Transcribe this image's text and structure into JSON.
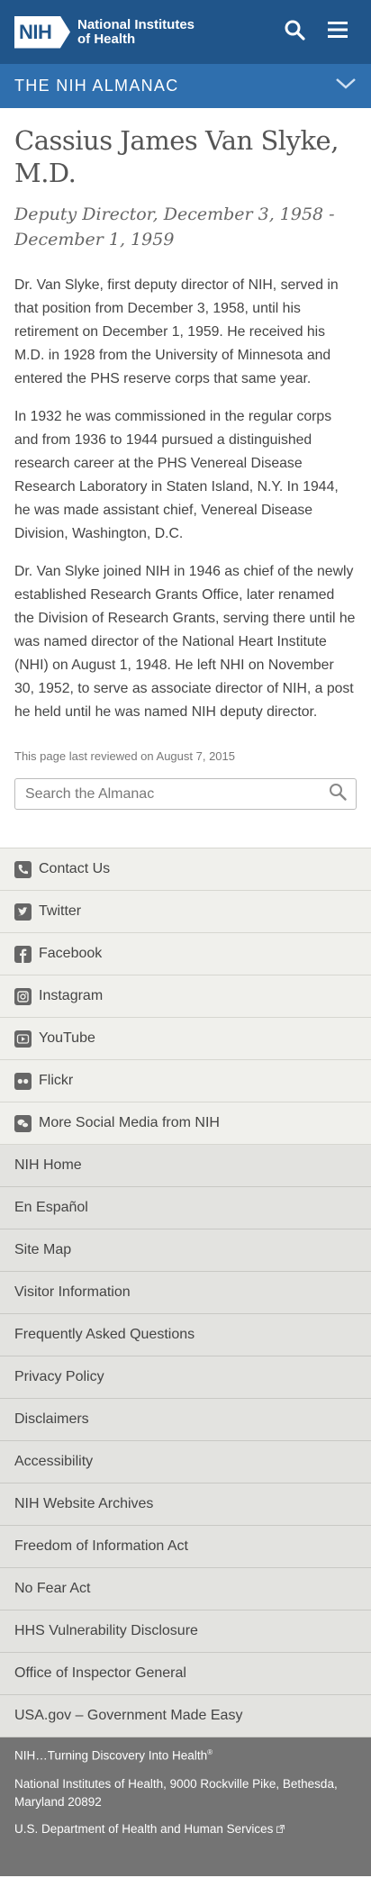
{
  "header": {
    "logo_mark": "NIH",
    "logo_line1": "National Institutes",
    "logo_line2": "of Health"
  },
  "almanac_bar": {
    "title": "THE NIH ALMANAC"
  },
  "main": {
    "title": "Cassius James Van Slyke, M.D.",
    "subtitle": "Deputy Director, December 3, 1958 - December 1, 1959",
    "paragraphs": [
      "Dr. Van Slyke, first deputy director of NIH, served in that position from December 3, 1958, until his retirement on December 1, 1959. He received his M.D. in 1928 from the University of Minnesota and entered the PHS reserve corps that same year.",
      "In 1932 he was commissioned in the regular corps and from 1936 to 1944 pursued a distinguished research career at the PHS Venereal Disease Research Laboratory in Staten Island, N.Y. In 1944, he was made assistant chief, Venereal Disease Division, Washington, D.C.",
      "Dr. Van Slyke joined NIH in 1946 as chief of the newly established Research Grants Office, later renamed the Division of Research Grants, serving there until he was named director of the National Heart Institute (NHI) on August 1, 1948. He left NHI on November 30, 1952, to serve as associate director of NIH, a post he held until he was named NIH deputy director."
    ],
    "reviewed": "This page last reviewed on August 7, 2015",
    "search_placeholder": "Search the Almanac"
  },
  "social_links": [
    {
      "label": "Contact Us",
      "icon": "phone-icon"
    },
    {
      "label": "Twitter",
      "icon": "twitter-icon"
    },
    {
      "label": "Facebook",
      "icon": "facebook-icon"
    },
    {
      "label": "Instagram",
      "icon": "instagram-icon"
    },
    {
      "label": "YouTube",
      "icon": "youtube-icon"
    },
    {
      "label": "Flickr",
      "icon": "flickr-icon"
    },
    {
      "label": "More Social Media from NIH",
      "icon": "social-media-icon"
    }
  ],
  "footer_links": [
    "NIH Home",
    "En Español",
    "Site Map",
    "Visitor Information",
    "Frequently Asked Questions",
    "Privacy Policy",
    "Disclaimers",
    "Accessibility",
    "NIH Website Archives",
    "Freedom of Information Act",
    "No Fear Act",
    "HHS Vulnerability Disclosure",
    "Office of Inspector General",
    "USA.gov – Government Made Easy"
  ],
  "bottom": {
    "tagline": "NIH…Turning Discovery Into Health",
    "tagline_mark": "®",
    "address": "National Institutes of Health, 9000 Rockville Pike, Bethesda, Maryland 20892",
    "hhs": "U.S. Department of Health and Human Services"
  },
  "colors": {
    "header_bg": "#20558a",
    "almanac_bar_bg": "#2f6fae",
    "social_bg": "#f0f0ec",
    "links_bg": "#e3e3e0",
    "bottom_bg": "#747474"
  }
}
